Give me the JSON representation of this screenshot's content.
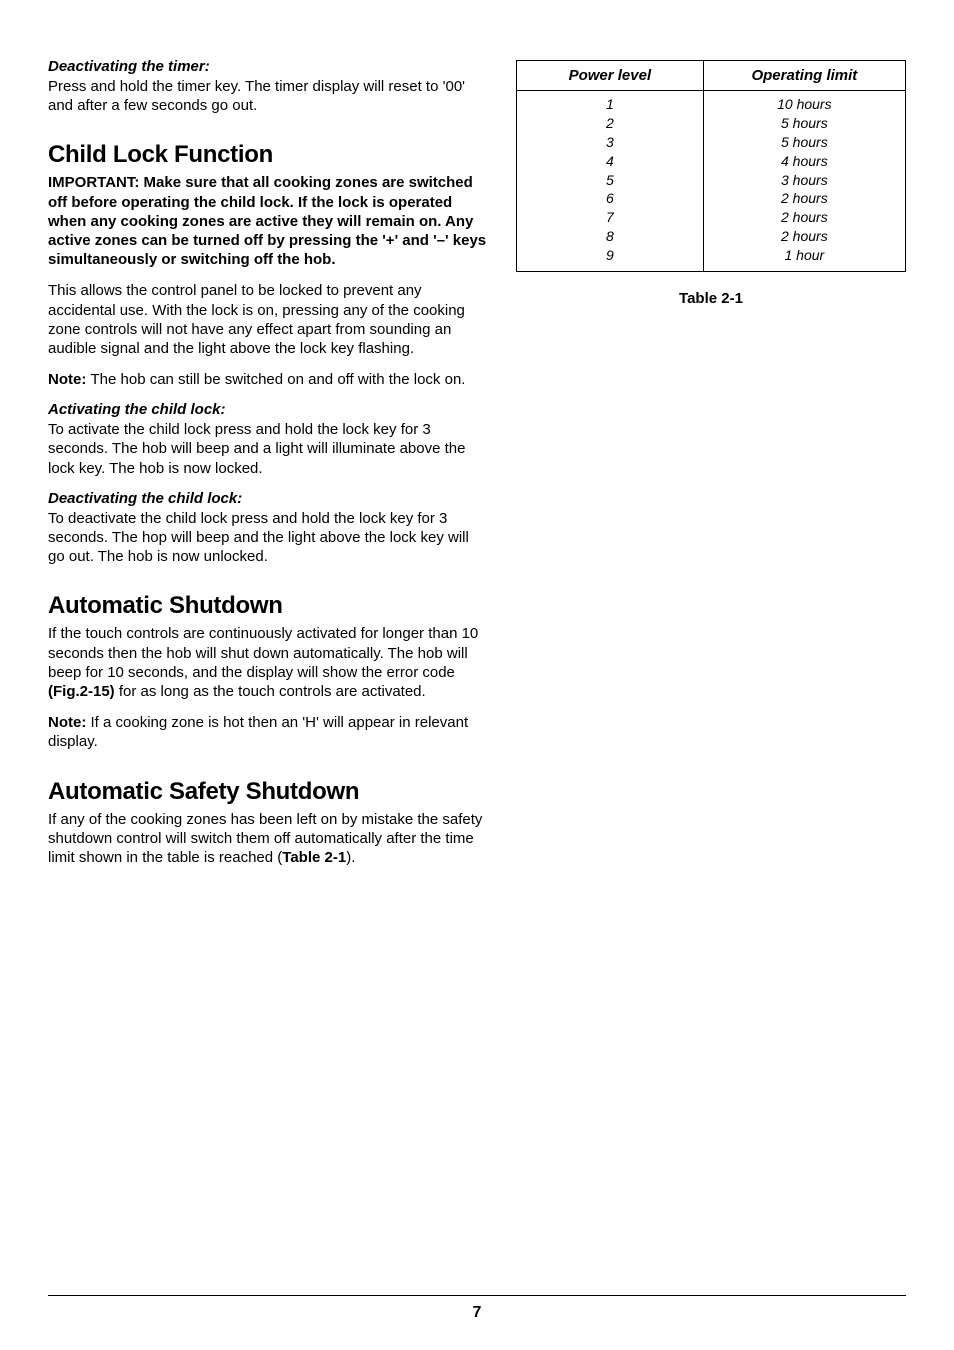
{
  "left": {
    "deactivating_timer_heading": "Deactivating the timer:",
    "deactivating_timer_body": "Press and hold the timer key. The timer display will reset to '00' and after a few seconds go out.",
    "child_lock_heading": "Child Lock Function",
    "child_lock_important_label": "IMPORTANT: ",
    "child_lock_important_body": "Make sure that all cooking zones are switched off before operating the child lock. If the lock is operated when any cooking zones are active they will remain on. Any active zones can be turned off by pressing the '+' and '–' keys simultaneously or switching off the hob.",
    "child_lock_p2": "This allows the control panel to be locked to prevent any accidental use. With the lock is on, pressing any of the cooking zone controls will not have any effect apart from sounding an audible signal and the light above the lock key flashing.",
    "child_lock_note_label": "Note: ",
    "child_lock_note_body": "The hob can still be switched on and off with the lock on.",
    "activating_child_lock_heading": "Activating the child lock:",
    "activating_child_lock_body": "To activate the child lock press and hold the lock key for 3 seconds. The hob will beep and a light will illuminate above the lock key. The hob is now locked.",
    "deactivating_child_lock_heading": "Deactivating the child lock:",
    "deactivating_child_lock_body": "To deactivate the child lock press and hold the lock key for 3 seconds. The hop will beep and the light above the lock key will go out. The hob is now unlocked.",
    "auto_shutdown_heading": "Automatic Shutdown",
    "auto_shutdown_p1_a": "If the touch controls are continuously activated for longer than 10 seconds then the hob will shut down automatically. The hob will beep for 10 seconds, and the display will show the error code ",
    "auto_shutdown_p1_b_strong": "(Fig.2-15)",
    "auto_shutdown_p1_c": " for as long as the touch controls are activated.",
    "auto_shutdown_note_label": "Note: ",
    "auto_shutdown_note_body": "If a cooking zone is hot then an 'H' will appear in relevant display.",
    "safety_shutdown_heading": "Automatic Safety Shutdown",
    "safety_shutdown_body_a": "If any of the cooking zones has been left on by mistake the safety shutdown control will switch them off automatically after the time limit shown in the table is reached (",
    "safety_shutdown_body_b_strong": "Table 2-1",
    "safety_shutdown_body_c": ")."
  },
  "table": {
    "header_power": "Power level",
    "header_limit": "Operating limit",
    "rows": [
      {
        "power": "1",
        "limit": "10 hours"
      },
      {
        "power": "2",
        "limit": "5 hours"
      },
      {
        "power": "3",
        "limit": "5 hours"
      },
      {
        "power": "4",
        "limit": "4 hours"
      },
      {
        "power": "5",
        "limit": "3 hours"
      },
      {
        "power": "6",
        "limit": "2 hours"
      },
      {
        "power": "7",
        "limit": "2 hours"
      },
      {
        "power": "8",
        "limit": "2 hours"
      },
      {
        "power": "9",
        "limit": "1 hour"
      }
    ],
    "caption": "Table 2-1"
  },
  "page_number": "7"
}
